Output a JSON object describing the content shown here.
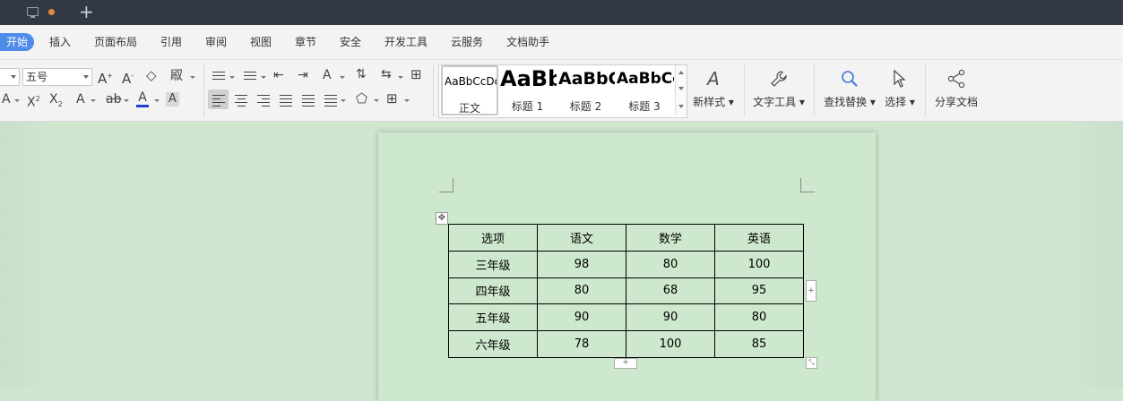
{
  "menu": {
    "items": [
      "开始",
      "插入",
      "页面布局",
      "引用",
      "审阅",
      "视图",
      "章节",
      "安全",
      "开发工具",
      "云服务",
      "文档助手"
    ]
  },
  "ribbon": {
    "font_size": "五号",
    "styles": [
      {
        "sample": "AaBbCcDd",
        "label": "正文"
      },
      {
        "sample": "AaBb",
        "label": "标题 1"
      },
      {
        "sample": "AaBbC",
        "label": "标题 2"
      },
      {
        "sample": "AaBbCc",
        "label": "标题 3"
      }
    ],
    "new_style_label": "新样式",
    "text_tools_label": "文字工具",
    "find_replace_label": "查找替换",
    "select_label": "选择",
    "share_label": "分享文档"
  },
  "table": {
    "headers": [
      "选项",
      "语文",
      "数学",
      "英语"
    ],
    "rows": [
      [
        "三年级",
        "98",
        "80",
        "100"
      ],
      [
        "四年级",
        "80",
        "68",
        "95"
      ],
      [
        "五年级",
        "90",
        "90",
        "80"
      ],
      [
        "六年级",
        "78",
        "100",
        "85"
      ]
    ]
  },
  "colors": {
    "titlebar": "#323844",
    "accent": "#4f8be8",
    "page_bg": "#cde8cc",
    "tab_dot": "#e6893f"
  }
}
